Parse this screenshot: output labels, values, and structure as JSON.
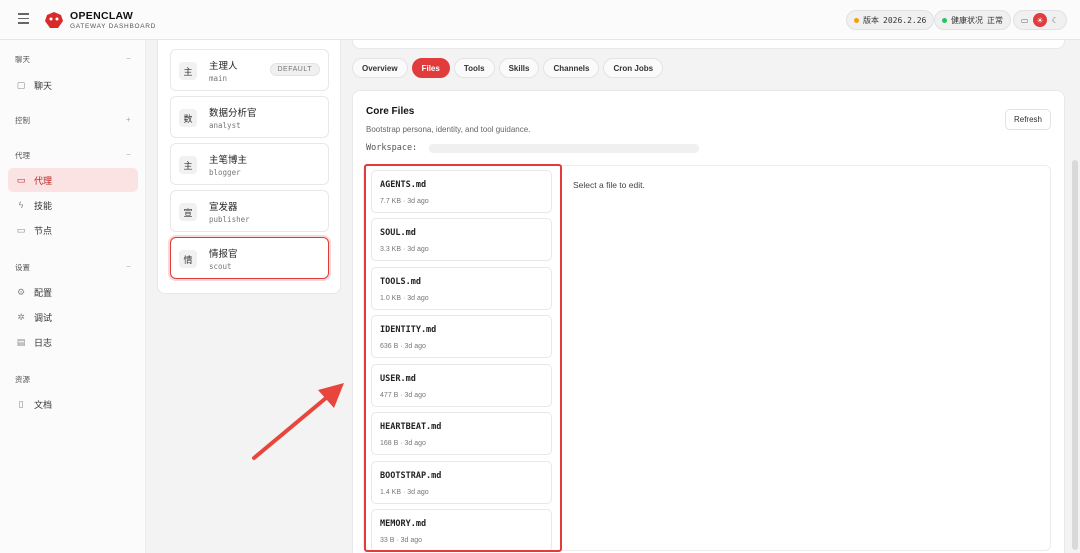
{
  "header": {
    "brand_name": "OPENCLAW",
    "brand_sub": "GATEWAY DASHBOARD",
    "version_label": "版本",
    "version_value": "2026.2.26",
    "health_label": "健康状况",
    "health_value": "正常",
    "colors": {
      "version_dot": "#f59e0b",
      "health_dot": "#22c55e",
      "accent": "#e23b3b"
    }
  },
  "sidebar": {
    "groups": [
      {
        "label": "聊天",
        "toggle": "−",
        "items": [
          {
            "label": "聊天",
            "icon": "chat-icon"
          }
        ]
      },
      {
        "label": "控制",
        "toggle": "+",
        "items": []
      },
      {
        "label": "代理",
        "toggle": "−",
        "items": [
          {
            "label": "代理",
            "icon": "folder-icon",
            "active": true
          },
          {
            "label": "技能",
            "icon": "bolt-icon"
          },
          {
            "label": "节点",
            "icon": "monitor-icon"
          }
        ]
      },
      {
        "label": "设置",
        "toggle": "−",
        "items": [
          {
            "label": "配置",
            "icon": "gear-icon"
          },
          {
            "label": "调试",
            "icon": "bug-icon"
          },
          {
            "label": "日志",
            "icon": "log-icon"
          }
        ]
      },
      {
        "label": "资源",
        "toggle": "",
        "items": [
          {
            "label": "文档",
            "icon": "book-icon"
          }
        ]
      }
    ]
  },
  "agents": [
    {
      "avatar": "主",
      "name": "主理人",
      "id": "main",
      "badge": "DEFAULT"
    },
    {
      "avatar": "数",
      "name": "数据分析官",
      "id": "analyst"
    },
    {
      "avatar": "主",
      "name": "主笔博主",
      "id": "blogger"
    },
    {
      "avatar": "宣",
      "name": "宣发器",
      "id": "publisher"
    },
    {
      "avatar": "情",
      "name": "情报官",
      "id": "scout",
      "selected": true
    }
  ],
  "tabs": [
    {
      "label": "Overview"
    },
    {
      "label": "Files",
      "active": true
    },
    {
      "label": "Tools"
    },
    {
      "label": "Skills"
    },
    {
      "label": "Channels"
    },
    {
      "label": "Cron Jobs"
    }
  ],
  "core_files": {
    "title": "Core Files",
    "description": "Bootstrap persona, identity, and tool guidance.",
    "workspace_label": "Workspace:",
    "refresh_label": "Refresh",
    "empty_hint": "Select a file to edit.",
    "files": [
      {
        "name": "AGENTS.md",
        "meta": "7.7 KB · 3d ago"
      },
      {
        "name": "SOUL.md",
        "meta": "3.3 KB · 3d ago"
      },
      {
        "name": "TOOLS.md",
        "meta": "1.0 KB · 3d ago"
      },
      {
        "name": "IDENTITY.md",
        "meta": "636 B · 3d ago"
      },
      {
        "name": "USER.md",
        "meta": "477 B · 3d ago"
      },
      {
        "name": "HEARTBEAT.md",
        "meta": "168 B · 3d ago"
      },
      {
        "name": "BOOTSTRAP.md",
        "meta": "1.4 KB · 3d ago"
      },
      {
        "name": "MEMORY.md",
        "meta": "33 B · 3d ago"
      }
    ]
  }
}
